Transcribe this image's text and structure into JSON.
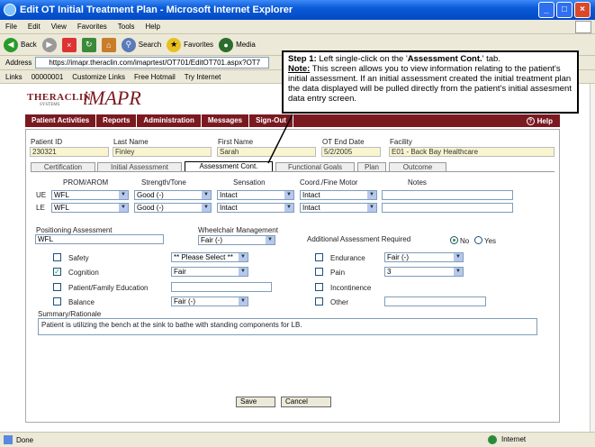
{
  "window": {
    "title": "Edit OT Initial Treatment Plan - Microsoft Internet Explorer"
  },
  "menu": [
    "File",
    "Edit",
    "View",
    "Favorites",
    "Tools",
    "Help"
  ],
  "toolbar": {
    "back": "Back",
    "search": "Search",
    "favorites": "Favorites",
    "media": "Media"
  },
  "address": {
    "label": "Address",
    "url": "https://imapr.theraclin.com/imaprtest/OT701/EditOT701.aspx?OT7"
  },
  "links": {
    "label": "Links",
    "items": [
      "00000001",
      "Customize Links",
      "Free Hotmail",
      "Try Internet"
    ]
  },
  "brand": {
    "name": "THERACLIN",
    "systems": "SYSTEMS",
    "product": "iMAPR"
  },
  "nav": {
    "items": [
      "Patient Activities",
      "Reports",
      "Administration",
      "Messages",
      "Sign-Out"
    ],
    "help": "Help"
  },
  "patient": {
    "id_label": "Patient ID",
    "id": "230321",
    "last_label": "Last Name",
    "last": "Finley",
    "first_label": "First Name",
    "first": "Sarah",
    "end_label": "OT End Date",
    "end": "5/2/2005",
    "facility_label": "Facility",
    "facility": "E01 - Back Bay Healthcare"
  },
  "tabs": [
    "Certification",
    "Initial Assessment",
    "Assessment Cont.",
    "Functional Goals",
    "Plan",
    "Outcome"
  ],
  "grid": {
    "headers": [
      "PROM/AROM",
      "Strength/Tone",
      "Sensation",
      "Coord./Fine Motor",
      "Notes"
    ],
    "ue_label": "UE",
    "le_label": "LE",
    "ue": [
      "WFL",
      "Good (-)",
      "Intact",
      "Intact"
    ],
    "le": [
      "WFL",
      "Good (-)",
      "Intact",
      "Intact"
    ]
  },
  "positioning": {
    "label": "Positioning Assessment",
    "value": "WFL"
  },
  "wheelchair": {
    "label": "Wheelchair Management",
    "value": "Fair (-)"
  },
  "additional": {
    "label": "Additional Assessment Required",
    "no": "No",
    "yes": "Yes"
  },
  "left_checks": [
    {
      "label": "Safety",
      "checked": false,
      "value": "** Please Select **"
    },
    {
      "label": "Cognition",
      "checked": true,
      "value": "Fair"
    },
    {
      "label": "Patient/Family Education",
      "checked": false,
      "value": ""
    },
    {
      "label": "Balance",
      "checked": false,
      "value": "Fair (-)"
    }
  ],
  "right_checks": [
    {
      "label": "Endurance",
      "checked": false,
      "value": "Fair (-)"
    },
    {
      "label": "Pain",
      "checked": false,
      "value": "3"
    },
    {
      "label": "Incontinence",
      "checked": false,
      "value": ""
    },
    {
      "label": "Other",
      "checked": false,
      "value": ""
    }
  ],
  "summary": {
    "label": "Summary/Rationale",
    "text": "Patient is utilizing the bench at the sink to bathe with standing components for LB."
  },
  "buttons": {
    "save": "Save",
    "cancel": "Cancel"
  },
  "status": {
    "left": "Done",
    "zone": "Internet"
  },
  "callout": {
    "step": "Step 1:",
    "step_text": " Left single-click on the '",
    "tab_name": "Assessment Cont.",
    "step_end": "' tab.",
    "note": "Note:",
    "note_text": " This screen allows you to view information relating to the patient's initial assessment. If an initial assessment created the initial treatment plan the data displayed will be pulled directly from the patient's initial assesment data entry screen."
  },
  "colors": {
    "brand": "#7a1a20",
    "readonly": "#f8f5d0",
    "titlebar": "#0a5bd8"
  }
}
